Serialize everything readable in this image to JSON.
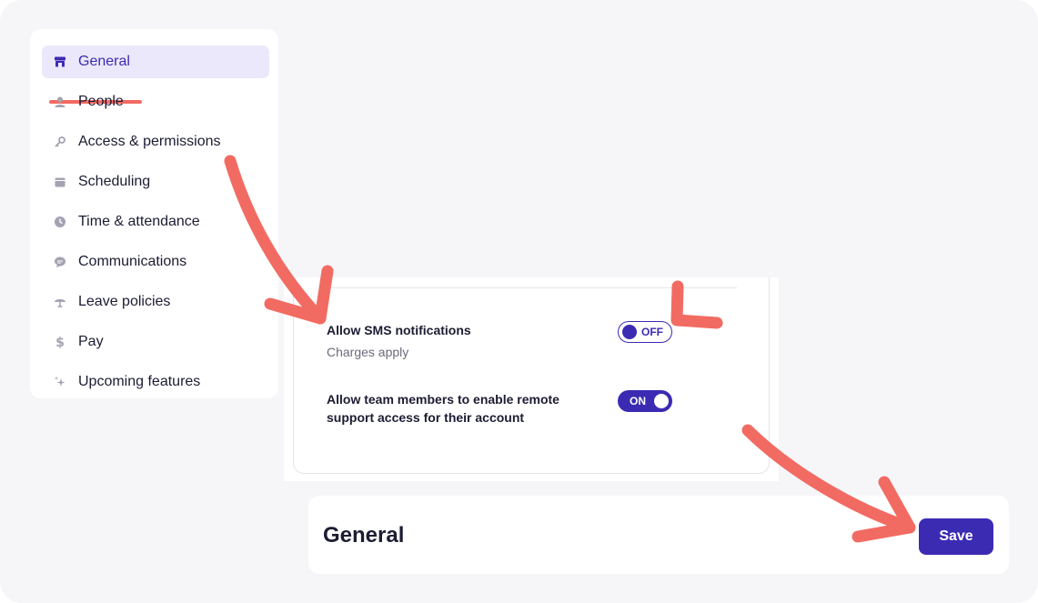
{
  "sidebar": {
    "items": [
      {
        "label": "General",
        "icon": "store-icon",
        "active": true
      },
      {
        "label": "People",
        "icon": "person-icon"
      },
      {
        "label": "Access & permissions",
        "icon": "key-icon"
      },
      {
        "label": "Scheduling",
        "icon": "calendar-icon"
      },
      {
        "label": "Time & attendance",
        "icon": "clock-icon"
      },
      {
        "label": "Communications",
        "icon": "chat-icon"
      },
      {
        "label": "Leave policies",
        "icon": "umbrella-icon"
      },
      {
        "label": "Pay",
        "icon": "dollar-icon"
      },
      {
        "label": "Upcoming features",
        "icon": "sparkle-icon"
      }
    ]
  },
  "settings": {
    "sms": {
      "title": "Allow SMS notifications",
      "subtitle": "Charges apply",
      "toggle_label": "OFF",
      "enabled": false
    },
    "remote": {
      "title_line1": "Allow team members to enable remote",
      "title_line2": "support access for their account",
      "toggle_label": "ON",
      "enabled": true
    }
  },
  "footer": {
    "title": "General",
    "save_label": "Save"
  },
  "colors": {
    "accent": "#3b2bb3",
    "active_bg": "#ece8fb",
    "annotation": "#f26b62",
    "canvas_bg": "#f6f6f9"
  }
}
